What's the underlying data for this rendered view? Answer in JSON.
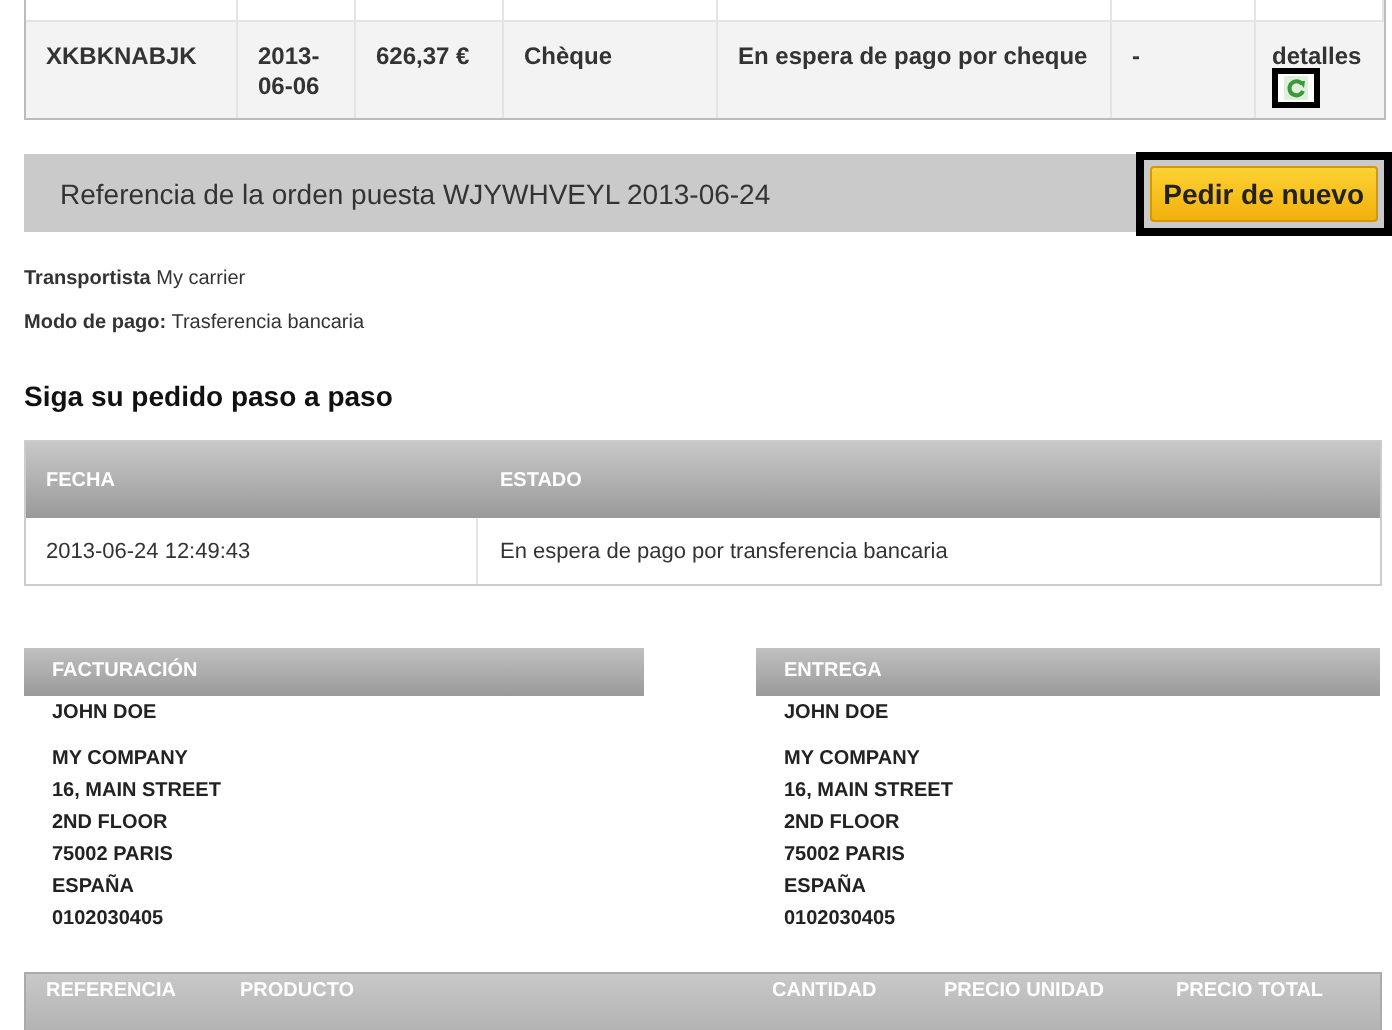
{
  "orders_table": {
    "rows": [
      {
        "cells": [
          "XKBKNABJK",
          "2013-06-06",
          "626,37 €",
          "Chèque",
          "En espera de pago por cheque",
          "-"
        ],
        "details_link": "detalles"
      }
    ]
  },
  "order_bar": {
    "title": "Referencia de la orden puesta WJYWHVEYL 2013-06-24",
    "reorder_button": "Pedir de nuevo"
  },
  "info": [
    {
      "label": "Transportista",
      "value": "My carrier"
    },
    {
      "label": "Modo de pago:",
      "value": "Trasferencia bancaria"
    }
  ],
  "tracking": {
    "heading": "Siga su pedido paso a paso",
    "columns": [
      "FECHA",
      "ESTADO"
    ],
    "rows": [
      [
        "2013-06-24 12:49:43",
        "En espera de pago por transferencia bancaria"
      ]
    ]
  },
  "addresses": [
    {
      "title": "FACTURACIÓN",
      "name": "JOHN DOE",
      "lines": [
        "MY COMPANY",
        "16, MAIN STREET",
        "2ND FLOOR",
        "75002 PARIS",
        "ESPAÑA",
        "0102030405"
      ]
    },
    {
      "title": "ENTREGA",
      "name": "JOHN DOE",
      "lines": [
        "MY COMPANY",
        "16, MAIN STREET",
        "2ND FLOOR",
        "75002 PARIS",
        "ESPAÑA",
        "0102030405"
      ]
    }
  ],
  "products_table": {
    "columns": [
      "REFERENCIA",
      "PRODUCTO",
      "CANTIDAD",
      "PRECIO UNIDAD",
      "PRECIO TOTAL"
    ]
  }
}
